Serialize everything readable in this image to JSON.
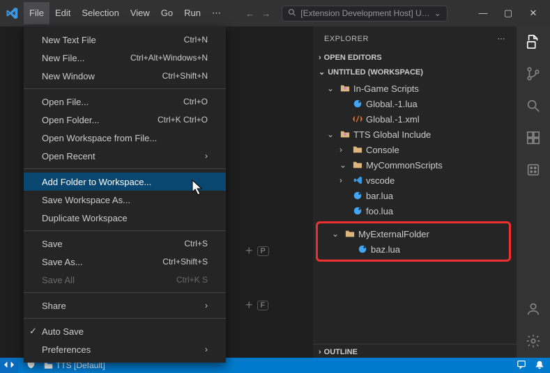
{
  "menu": {
    "items": [
      "File",
      "Edit",
      "Selection",
      "View",
      "Go",
      "Run"
    ],
    "overflow": "⋯"
  },
  "title_center": {
    "search_label": "[Extension Development Host] U…"
  },
  "dropdown": {
    "groups": [
      [
        {
          "label": "New Text File",
          "keys": "Ctrl+N"
        },
        {
          "label": "New File...",
          "keys": "Ctrl+Alt+Windows+N"
        },
        {
          "label": "New Window",
          "keys": "Ctrl+Shift+N"
        }
      ],
      [
        {
          "label": "Open File...",
          "keys": "Ctrl+O"
        },
        {
          "label": "Open Folder...",
          "keys": "Ctrl+K Ctrl+O"
        },
        {
          "label": "Open Workspace from File..."
        },
        {
          "label": "Open Recent",
          "submenu": true
        }
      ],
      [
        {
          "label": "Add Folder to Workspace...",
          "hovered": true
        },
        {
          "label": "Save Workspace As..."
        },
        {
          "label": "Duplicate Workspace"
        }
      ],
      [
        {
          "label": "Save",
          "keys": "Ctrl+S"
        },
        {
          "label": "Save As...",
          "keys": "Ctrl+Shift+S"
        },
        {
          "label": "Save All",
          "keys": "Ctrl+K S",
          "disabled": true
        }
      ],
      [
        {
          "label": "Share",
          "submenu": true
        }
      ],
      [
        {
          "label": "Auto Save",
          "checked": true
        },
        {
          "label": "Preferences",
          "submenu": true
        }
      ]
    ]
  },
  "explorer": {
    "title": "EXPLORER",
    "open_editors": "OPEN EDITORS",
    "workspace": "UNTITLED (WORKSPACE)",
    "outline": "OUTLINE",
    "tree": [
      {
        "depth": 1,
        "icon": "dice",
        "chev": "v",
        "label": "In-Game Scripts",
        "type": "folder"
      },
      {
        "depth": 2,
        "icon": "lua",
        "label": "Global.-1.lua",
        "type": "file"
      },
      {
        "depth": 2,
        "icon": "xml",
        "label": "Global.-1.xml",
        "type": "file"
      },
      {
        "depth": 1,
        "icon": "dice",
        "chev": "v",
        "label": "TTS Global Include",
        "type": "folder"
      },
      {
        "depth": 2,
        "icon": "folder",
        "chev": ">",
        "label": "Console",
        "type": "folder"
      },
      {
        "depth": 2,
        "icon": "folder",
        "chev": "v",
        "label": "MyCommonScripts",
        "type": "folder"
      },
      {
        "depth": 2,
        "icon": "vs",
        "chev": ">",
        "label": "vscode",
        "type": "folder"
      },
      {
        "depth": 2,
        "icon": "lua",
        "label": "bar.lua",
        "type": "file"
      },
      {
        "depth": 2,
        "icon": "lua",
        "label": "foo.lua",
        "type": "file"
      }
    ],
    "highlighted": [
      {
        "depth": 1,
        "icon": "folder",
        "chev": "v",
        "label": "MyExternalFolder",
        "type": "folder"
      },
      {
        "depth": 2,
        "icon": "lua",
        "label": "baz.lua",
        "type": "file"
      }
    ]
  },
  "status": {
    "project": "TTS [Default]"
  },
  "editor_hints": {
    "key_p": "P",
    "key_f": "F"
  }
}
